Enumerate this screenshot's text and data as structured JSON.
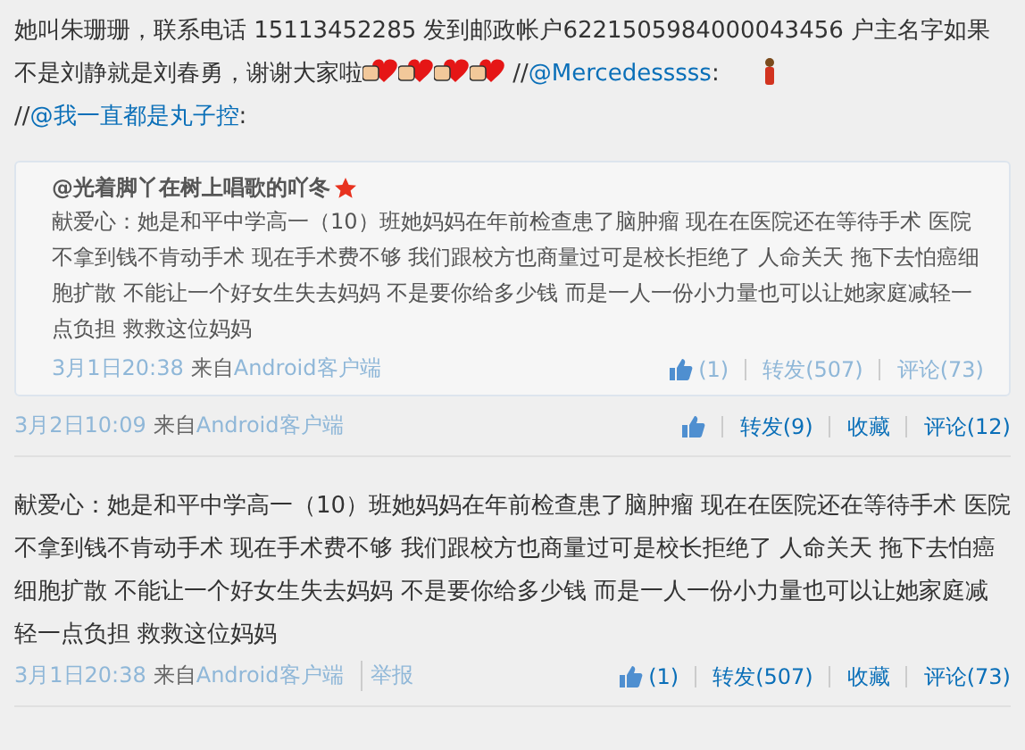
{
  "post": {
    "parts": [
      {
        "kind": "text",
        "text": "她叫朱珊珊，联系电话 15113452285 发到邮政帐户6221505984000043456 户主名字如果不是刘静就是刘春勇，谢谢大家啦"
      },
      {
        "kind": "emoji"
      },
      {
        "kind": "emoji"
      },
      {
        "kind": "emoji"
      },
      {
        "kind": "emoji"
      },
      {
        "kind": "text",
        "text": " //"
      },
      {
        "kind": "link",
        "text": "@Mercedesssss"
      },
      {
        "kind": "text",
        "text": ":  "
      },
      {
        "kind": "figure"
      },
      {
        "kind": "text",
        "text": "//"
      },
      {
        "kind": "link",
        "text": "@我一直都是丸子控"
      },
      {
        "kind": "text",
        "text": ":"
      }
    ],
    "quote": {
      "author": "@光着脚丫在树上唱歌的吖冬",
      "body": "献爱心：她是和平中学高一（10）班她妈妈在年前检查患了脑肿瘤 现在在医院还在等待手术 医院不拿到钱不肯动手术 现在手术费不够 我们跟校方也商量过可是校长拒绝了 人命关天 拖下去怕癌细胞扩散 不能让一个好女生失去妈妈 不是要你给多少钱 而是一人一份小力量也可以让她家庭减轻一点负担 救救这位妈妈",
      "time": "3月1日20:38",
      "from": "来自",
      "source": "Android客户端",
      "actions": [
        {
          "kind": "like",
          "text": "(1)"
        },
        {
          "kind": "text",
          "text": "转发(507)"
        },
        {
          "kind": "text",
          "text": "评论(73)"
        }
      ]
    },
    "time": "3月2日10:09",
    "from": "来自",
    "source": "Android客户端",
    "actions": [
      {
        "kind": "like"
      },
      {
        "kind": "text",
        "text": "转发(9)"
      },
      {
        "kind": "text",
        "text": "收藏"
      },
      {
        "kind": "text",
        "text": "评论(12)"
      }
    ]
  },
  "comment": {
    "body": "献爱心：她是和平中学高一（10）班她妈妈在年前检查患了脑肿瘤 现在在医院还在等待手术 医院不拿到钱不肯动手术 现在手术费不够 我们跟校方也商量过可是校长拒绝了 人命关天 拖下去怕癌细胞扩散 不能让一个好女生失去妈妈 不是要你给多少钱 而是一人一份小力量也可以让她家庭减轻一点负担 救救这位妈妈",
    "time": "3月1日20:38",
    "from": "来自",
    "source": "Android客户端",
    "report": "举报",
    "actions": [
      {
        "kind": "like",
        "text": "(1)"
      },
      {
        "kind": "text",
        "text": "转发(507)"
      },
      {
        "kind": "text",
        "text": "收藏"
      },
      {
        "kind": "text",
        "text": "评论(73)"
      }
    ]
  }
}
